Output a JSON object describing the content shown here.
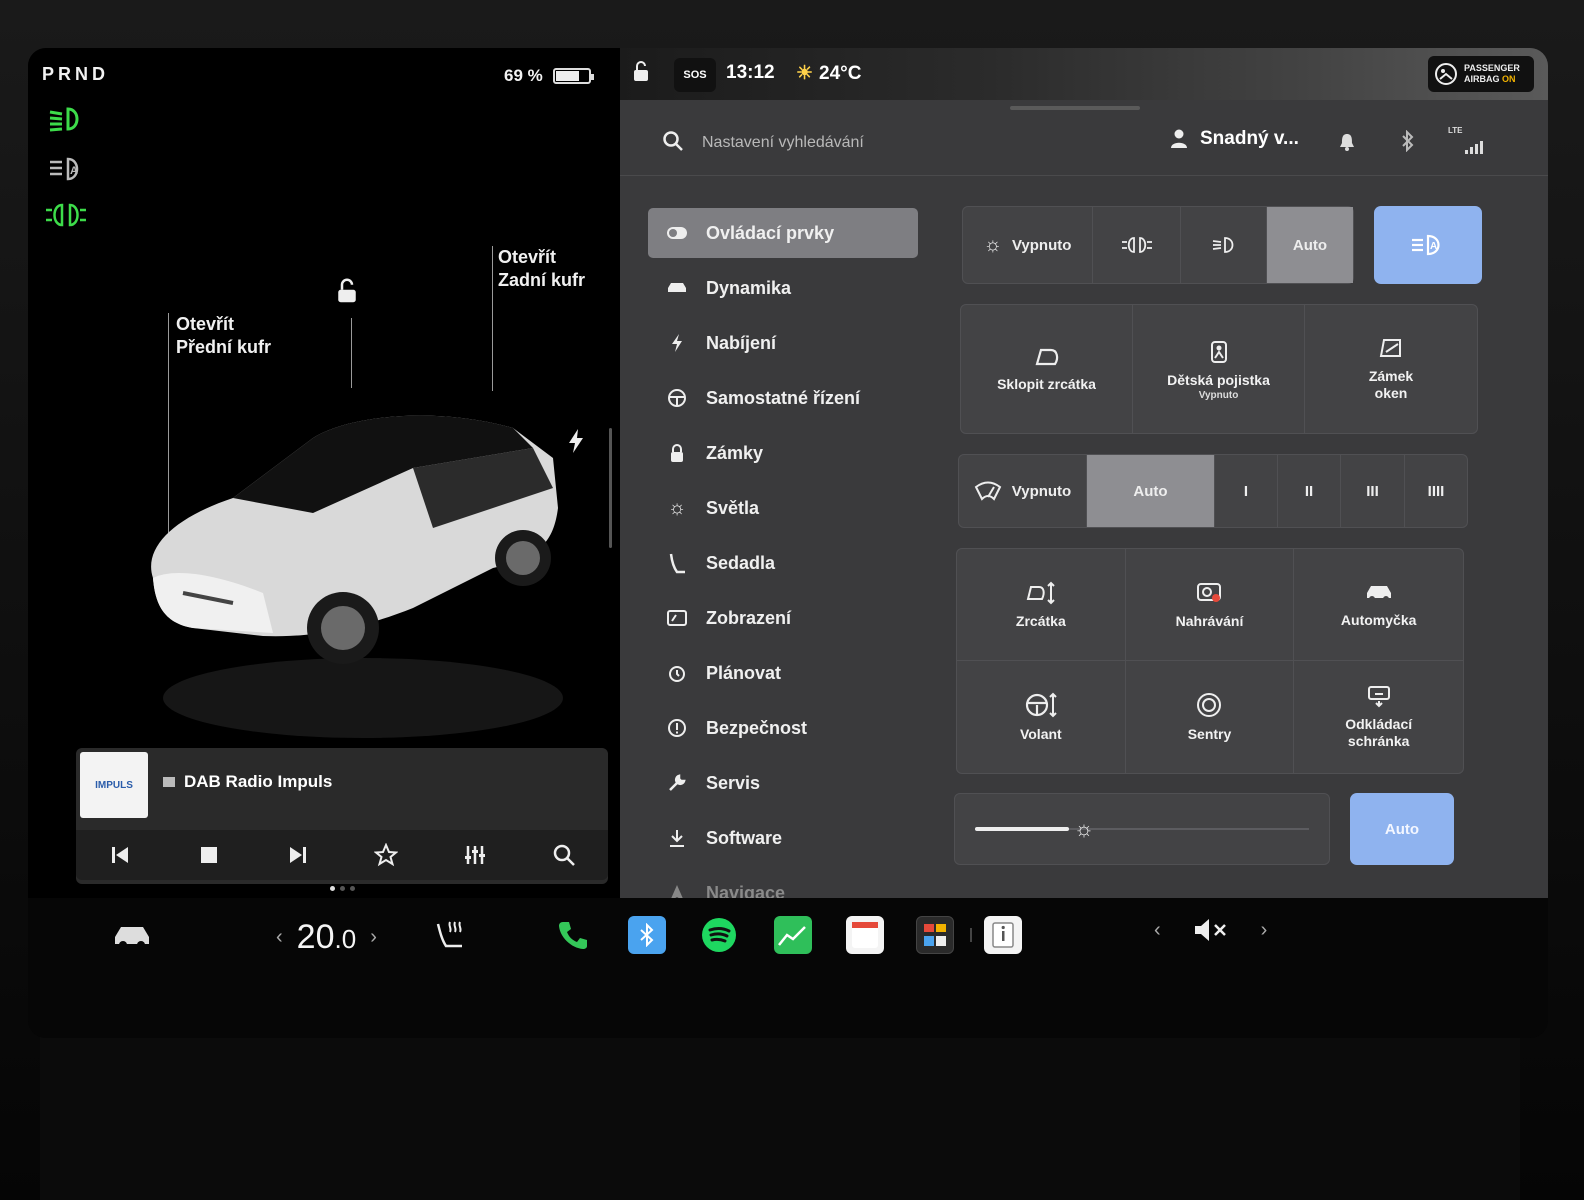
{
  "status": {
    "gear": "PRND",
    "battery_percent": "69 %",
    "battery_level": 0.69,
    "time": "13:12",
    "temperature": "24°C",
    "sos": "SOS",
    "airbag_line1": "PASSENGER",
    "airbag_line2": "AIRBAG",
    "airbag_state": "ON"
  },
  "car_view": {
    "frunk_line1": "Otevřít",
    "frunk_line2": "Přední kufr",
    "trunk_line1": "Otevřít",
    "trunk_line2": "Zadní kufr"
  },
  "media": {
    "art_label": "IMPULS",
    "station": "DAB Radio Impuls"
  },
  "search": {
    "placeholder": "Nastavení vyhledávání"
  },
  "profile": {
    "name": "Snadný v..."
  },
  "network": "LTE",
  "menu": {
    "items": [
      {
        "label": "Ovládací prvky",
        "icon": "toggle-icon"
      },
      {
        "label": "Dynamika",
        "icon": "car-icon"
      },
      {
        "label": "Nabíjení",
        "icon": "bolt-icon"
      },
      {
        "label": "Samostatné řízení",
        "icon": "steering-wheel-icon"
      },
      {
        "label": "Zámky",
        "icon": "lock-icon"
      },
      {
        "label": "Světla",
        "icon": "sun-icon"
      },
      {
        "label": "Sedadla",
        "icon": "seat-icon"
      },
      {
        "label": "Zobrazení",
        "icon": "display-icon"
      },
      {
        "label": "Plánovat",
        "icon": "alarm-clock-icon"
      },
      {
        "label": "Bezpečnost",
        "icon": "alert-icon"
      },
      {
        "label": "Servis",
        "icon": "wrench-icon"
      },
      {
        "label": "Software",
        "icon": "download-icon"
      },
      {
        "label": "Navigace",
        "icon": "navigation-icon"
      }
    ]
  },
  "lights": {
    "off": "Vypnuto",
    "auto": "Auto"
  },
  "tiles_row1": {
    "fold_mirrors": "Sklopit zrcátka",
    "child_lock": "Dětská pojistka",
    "child_lock_state": "Vypnuto",
    "window_lock_1": "Zámek",
    "window_lock_2": "oken"
  },
  "wipers": {
    "off": "Vypnuto",
    "auto": "Auto",
    "speeds": [
      "I",
      "II",
      "III",
      "IIII"
    ]
  },
  "tiles_grid": {
    "mirrors": "Zrcátka",
    "recording": "Nahrávání",
    "car_wash": "Automyčka",
    "steering": "Volant",
    "sentry": "Sentry",
    "glovebox_1": "Odkládací",
    "glovebox_2": "schránka"
  },
  "brightness": {
    "level": 0.28,
    "auto": "Auto"
  },
  "climate": {
    "temp_whole": "20",
    "temp_dec": ".0"
  },
  "colors": {
    "green_indicator": "#3ddc4a",
    "accent_blue": "#8fb3ef",
    "panel_bg": "#3a3a3c"
  }
}
